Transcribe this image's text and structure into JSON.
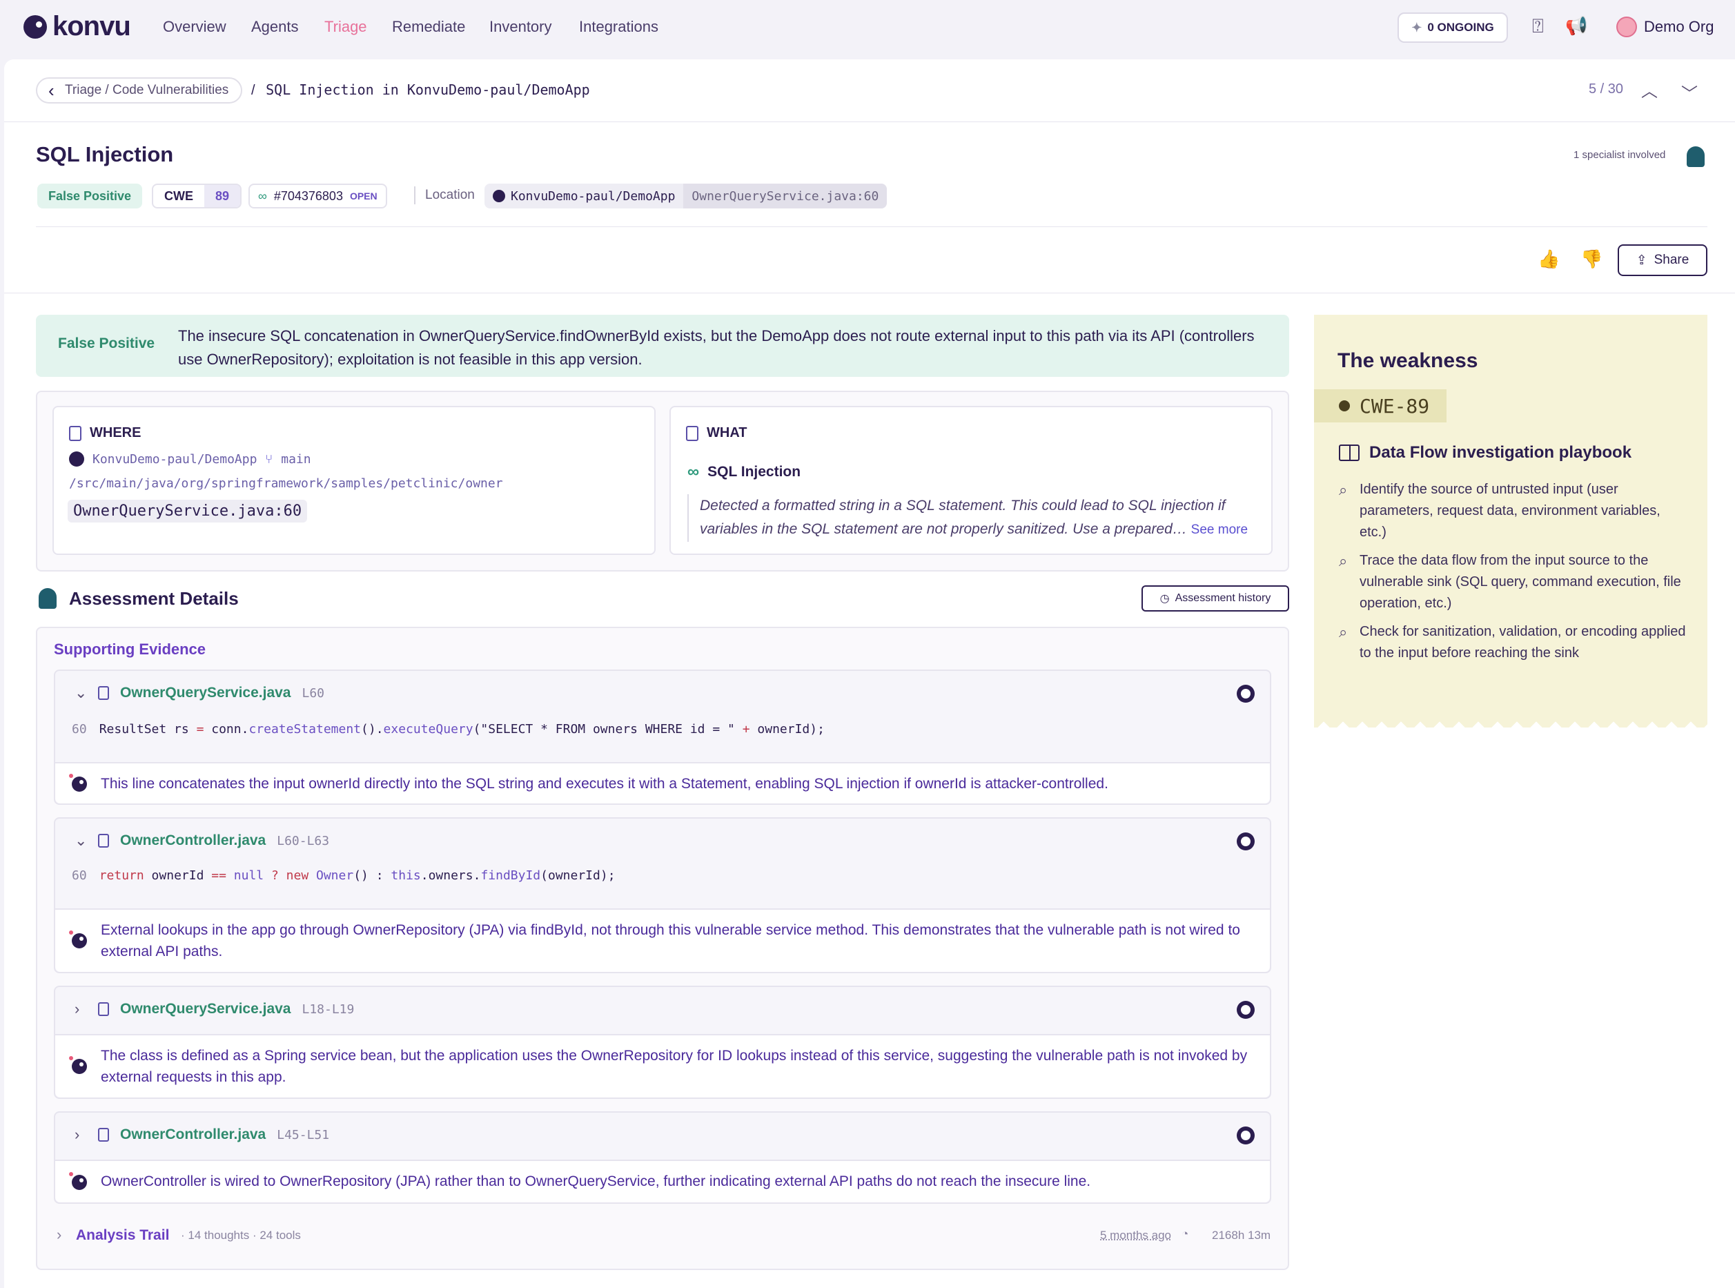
{
  "nav": {
    "brand": "konvu",
    "items": [
      {
        "label": "Overview",
        "active": false
      },
      {
        "label": "Agents",
        "active": false
      },
      {
        "label": "Triage",
        "active": true
      },
      {
        "label": "Remediate",
        "active": false
      },
      {
        "label": "Inventory",
        "active": false
      },
      {
        "label": "Integrations",
        "active": false
      }
    ],
    "ongoing_label": "0 ONGOING",
    "org_label": "Demo Org",
    "accent_color": "#e8719a"
  },
  "breadcrumb": {
    "parent": "Triage / Code Vulnerabilities",
    "separator": "/",
    "current": "SQL Injection in KonvuDemo-paul/DemoApp"
  },
  "pager": {
    "label": "5 / 30"
  },
  "finding": {
    "title": "SQL Injection",
    "status": "False Positive",
    "cwe_label": "CWE",
    "cwe_id": "89",
    "issue_id": "#704376803",
    "issue_state": "OPEN",
    "location_label": "Location",
    "repo": "KonvuDemo-paul/DemoApp",
    "file_ref": "OwnerQueryService.java:60",
    "specialists": "1 specialist involved",
    "share_label": "Share"
  },
  "verdict": {
    "label": "False Positive",
    "text": "The insecure SQL concatenation in OwnerQueryService.findOwnerById exists, but the DemoApp does not route external input to this path via its API (controllers use OwnerRepository); exploitation is not feasible in this app version."
  },
  "where": {
    "header": "WHERE",
    "repo": "KonvuDemo-paul/DemoApp",
    "branch": "main",
    "path": "/src/main/java/org/springframework/samples/petclinic/owner",
    "file": "OwnerQueryService.java:60"
  },
  "what": {
    "header": "WHAT",
    "name": "SQL Injection",
    "desc_line1": "Detected a formatted string in a SQL statement. This could lead to SQL injection if",
    "desc_line2": "variables in the SQL statement are not properly sanitized. Use a prepared…",
    "see_more": "See more"
  },
  "assessment": {
    "title": "Assessment Details",
    "history_label": "Assessment history",
    "evidence_title": "Supporting Evidence",
    "items": [
      {
        "file": "OwnerQueryService.java",
        "lines": "L60",
        "code_ln": "60",
        "code_a": "ResultSet rs ",
        "code_b": "=",
        "code_c": " conn.",
        "code_d": "createStatement",
        "code_e": "().",
        "code_f": "executeQuery",
        "code_g": "(\"SELECT * FROM owners WHERE id = \" ",
        "code_h": "+",
        "code_i": " ownerId);",
        "note": "This line concatenates the input ownerId directly into the SQL string and executes it with a Statement, enabling SQL injection if ownerId is attacker-controlled."
      },
      {
        "file": "OwnerController.java",
        "lines": "L60-L63",
        "code_ln": "60",
        "code_a": "return",
        "code_b": " ownerId ",
        "code_c": "==",
        "code_d": " null",
        "code_e": " ? ",
        "code_f": "new",
        "code_g": " Owner",
        "code_h": "() : ",
        "code_i": "this",
        "code_j": ".owners.",
        "code_k": "findById",
        "code_l": "(ownerId);",
        "note": "External lookups in the app go through OwnerRepository (JPA) via findById, not through this vulnerable service method. This demonstrates that the vulnerable path is not wired to external API paths."
      },
      {
        "file": "OwnerQueryService.java",
        "lines": "L18-L19",
        "note": "The class is defined as a Spring service bean, but the application uses the OwnerRepository for ID lookups instead of this service, suggesting the vulnerable path is not invoked by external requests in this app."
      },
      {
        "file": "OwnerController.java",
        "lines": "L45-L51",
        "note": "OwnerController is wired to OwnerRepository (JPA) rather than to OwnerQueryService, further indicating external API paths do not reach the insecure line."
      }
    ],
    "trail_label": "Analysis Trail",
    "trail_meta": "· 14 thoughts · 24 tools",
    "ago": "5 months ago",
    "duration": "2168h 13m"
  },
  "weakness": {
    "title": "The weakness",
    "cwe": "CWE-89",
    "playbook_title": "Data Flow investigation playbook",
    "steps": [
      "Identify the source of untrusted input (user parameters, request data, environment variables, etc.)",
      "Trace the data flow from the input source to the vulnerable sink (SQL query, command execution, file operation, etc.)",
      "Check for sanitization, validation, or encoding applied to the input before reaching the sink"
    ]
  }
}
